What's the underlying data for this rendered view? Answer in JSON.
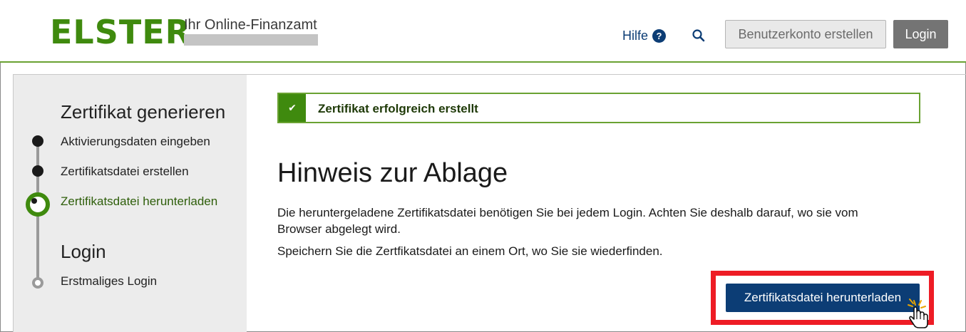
{
  "header": {
    "logo": "ELSTER",
    "tagline": "Ihr Online-Finanzamt",
    "help_label": "Hilfe",
    "help_icon_glyph": "?",
    "create_account_label": "Benutzerkonto erstellen",
    "login_label": "Login"
  },
  "sidebar": {
    "sections": [
      {
        "title": "Zertifikat generieren",
        "steps": [
          {
            "label": "Aktivierungsdaten eingeben",
            "state": "done"
          },
          {
            "label": "Zertifikatsdatei erstellen",
            "state": "done"
          },
          {
            "label": "Zertifikatsdatei herunterladen",
            "state": "active"
          }
        ]
      },
      {
        "title": "Login",
        "steps": [
          {
            "label": "Erstmaliges Login",
            "state": "open"
          }
        ]
      }
    ]
  },
  "main": {
    "success_message": "Zertifikat erfolgreich erstellt",
    "heading": "Hinweis zur Ablage",
    "paragraph1_line1": "Die heruntergeladene Zertifikatsdatei benötigen Sie bei jedem Login. Achten Sie deshalb darauf, wo sie vom",
    "paragraph1_line2": "Browser abgelegt wird.",
    "paragraph2": "Speichern Sie die Zertfikatsdatei an einem Ort, wo Sie sie wiederfinden.",
    "download_button_label": "Zertifikatsdatei herunterladen"
  },
  "colors": {
    "brand_green": "#3f8a0e",
    "primary_blue": "#0c3d75",
    "highlight_red": "#ee1c25"
  },
  "icons": [
    "help-icon",
    "search-icon",
    "check-icon",
    "hand-pointer-cursor-icon"
  ]
}
